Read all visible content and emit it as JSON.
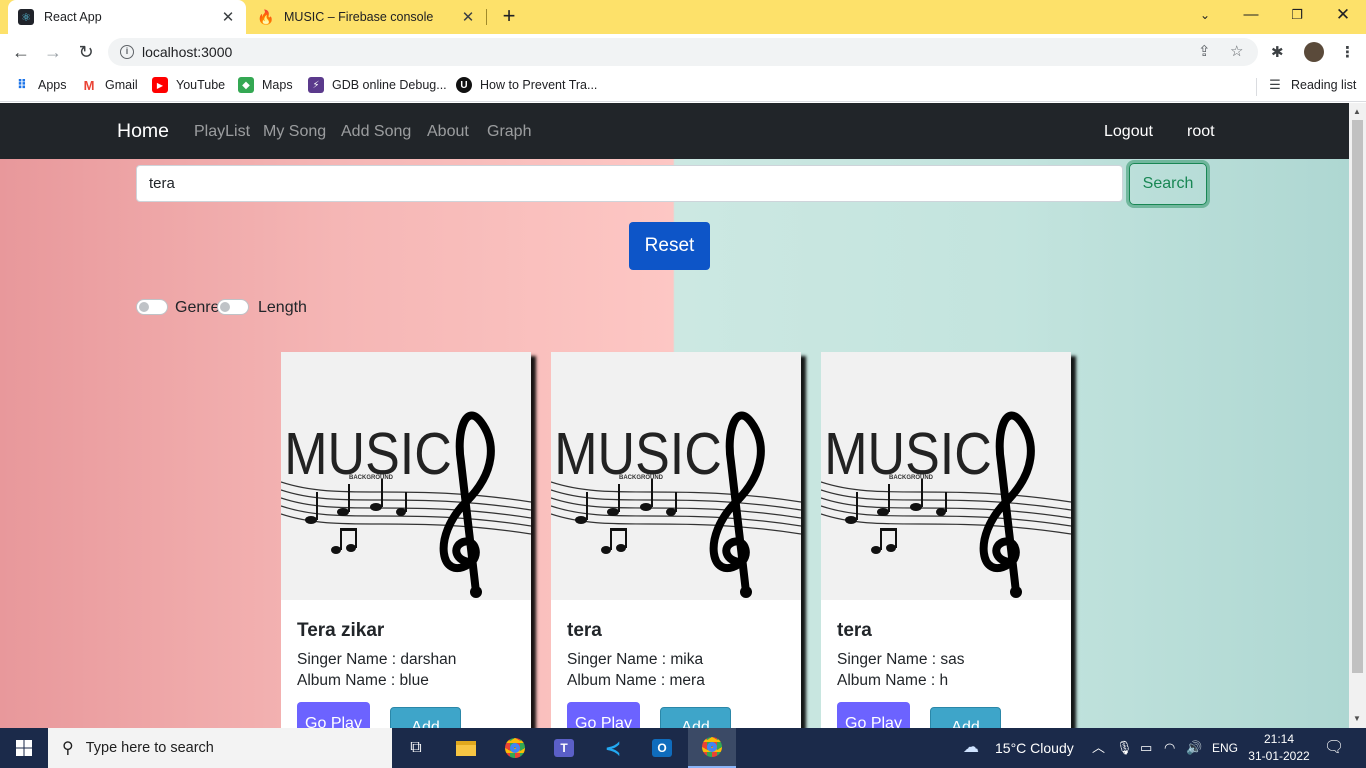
{
  "browser": {
    "tabs": [
      {
        "title": "React App"
      },
      {
        "title": "MUSIC – Firebase console"
      }
    ],
    "url": "localhost:3000",
    "bookmarks": [
      {
        "label": "Apps"
      },
      {
        "label": "Gmail"
      },
      {
        "label": "YouTube"
      },
      {
        "label": "Maps"
      },
      {
        "label": "GDB online Debug..."
      },
      {
        "label": "How to Prevent Tra..."
      }
    ],
    "reading_list": "Reading list"
  },
  "navbar": {
    "brand": "Home",
    "links": [
      "PlayList",
      "My Song",
      "Add Song",
      "About",
      "Graph"
    ],
    "logout": "Logout",
    "user": "root"
  },
  "search": {
    "value": "tera",
    "button": "Search"
  },
  "reset_label": "Reset",
  "filters": [
    {
      "label": "Genre",
      "checked": false
    },
    {
      "label": "Length",
      "checked": false
    }
  ],
  "art": {
    "title": "MUSIC",
    "subtitle": "BACKGROUND"
  },
  "songs": [
    {
      "title": "Tera zikar",
      "singer": "Singer Name : darshan",
      "album": "Album Name : blue",
      "play": "Go Play",
      "add": "Add"
    },
    {
      "title": "tera",
      "singer": "Singer Name : mika",
      "album": "Album Name : mera",
      "play": "Go Play",
      "add": "Add"
    },
    {
      "title": "tera",
      "singer": "Singer Name : sas",
      "album": "Album Name : h",
      "play": "Go Play",
      "add": "Add"
    }
  ],
  "taskbar": {
    "search_placeholder": "Type here to search",
    "weather": "15°C  Cloudy",
    "language": "ENG",
    "time": "21:14",
    "date": "31-01-2022"
  },
  "colors": {
    "tabstrip": "#fde16a",
    "navbar": "#212529",
    "search_button": "#198754",
    "reset_button": "#0d55c8",
    "play_button": "#6c63ff",
    "add_button": "#3ea5c9"
  }
}
